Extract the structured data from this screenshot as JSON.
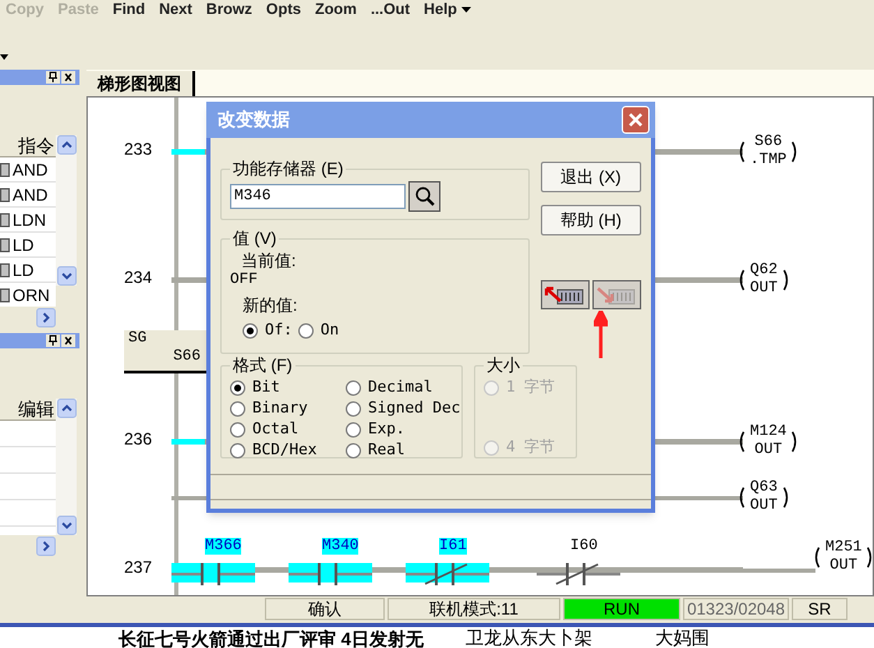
{
  "toolbar": {
    "items": [
      {
        "label": "Copy",
        "disabled": true
      },
      {
        "label": "Paste",
        "disabled": true
      },
      {
        "label": "Find",
        "disabled": false
      },
      {
        "label": "Next",
        "disabled": false
      },
      {
        "label": "Browz",
        "disabled": false
      },
      {
        "label": "Opts",
        "disabled": false
      },
      {
        "label": "Zoom",
        "disabled": false
      },
      {
        "label": "...Out",
        "disabled": false
      },
      {
        "label": "Help",
        "disabled": false,
        "has_menu": true
      }
    ]
  },
  "left_panels": [
    {
      "column": "指令",
      "rows": [
        "AND",
        "AND",
        "LDN",
        "LD",
        "LD",
        "ORN"
      ]
    },
    {
      "column": "编辑"
    }
  ],
  "tab": {
    "label": "梯形图视图",
    "selected": true
  },
  "ladder": {
    "rungs": [
      {
        "kind": "rung",
        "number": "233",
        "highlight": true,
        "coils": [
          {
            "name": "S66",
            "op": ".TMP"
          }
        ]
      },
      {
        "kind": "rung",
        "number": "234",
        "highlight": false,
        "coils": [
          {
            "name": "Q62",
            "op": "OUT"
          }
        ]
      },
      {
        "kind": "sg",
        "label": "SG",
        "operand": "S66"
      },
      {
        "kind": "rung",
        "number": "236",
        "highlight": true,
        "coils": [
          {
            "name": "M124",
            "op": "OUT"
          },
          {
            "name": "Q63",
            "op": "OUT"
          }
        ]
      },
      {
        "kind": "rung",
        "number": "237",
        "highlight": false,
        "contacts": [
          {
            "name": "M366",
            "kind": "no",
            "active": true
          },
          {
            "name": "M340",
            "kind": "no",
            "active": true
          },
          {
            "name": "I61",
            "kind": "nc",
            "active": true
          },
          {
            "name": "I60",
            "kind": "nc",
            "active": false
          }
        ],
        "coils": [
          {
            "name": "M251",
            "op": "OUT"
          }
        ]
      }
    ]
  },
  "dialog": {
    "title": "改变数据",
    "memory": {
      "label": "功能存储器 (E)",
      "value": "M346"
    },
    "buttons": [
      "退出 (X)",
      "帮助 (H)"
    ],
    "value": {
      "label": "值 (V)",
      "current_label": "当前值:",
      "current": "OFF",
      "new_label": "新的值:",
      "options": [
        {
          "label": "Of:",
          "selected": true
        },
        {
          "label": "On",
          "selected": false
        }
      ]
    },
    "transfer_buttons": [
      {
        "disabled": false
      },
      {
        "disabled": true
      }
    ],
    "format": {
      "label": "格式 (F)",
      "options": [
        {
          "label": "Bit",
          "selected": true
        },
        {
          "label": "Binary",
          "selected": false
        },
        {
          "label": "Octal",
          "selected": false
        },
        {
          "label": "BCD/Hex",
          "selected": false
        },
        {
          "label": "Decimal",
          "selected": false
        },
        {
          "label": "Signed Dec",
          "selected": false
        },
        {
          "label": "Exp.",
          "selected": false
        },
        {
          "label": "Real",
          "selected": false
        }
      ]
    },
    "size": {
      "label": "大小",
      "disabled": true,
      "options": [
        {
          "label": "1 字节",
          "selected": false
        },
        {
          "label": "4 字节",
          "selected": false
        }
      ]
    }
  },
  "status_bar": {
    "cells": [
      {
        "text": "确认"
      },
      {
        "text": "联机模式:11"
      },
      {
        "text": "RUN",
        "kind": "run"
      },
      {
        "text": "01323/02048"
      },
      {
        "text": "SR"
      }
    ]
  },
  "news": [
    "长征七号火箭通过出厂评审 4日发射无",
    "卫龙从东大卜架",
    "大妈围"
  ]
}
